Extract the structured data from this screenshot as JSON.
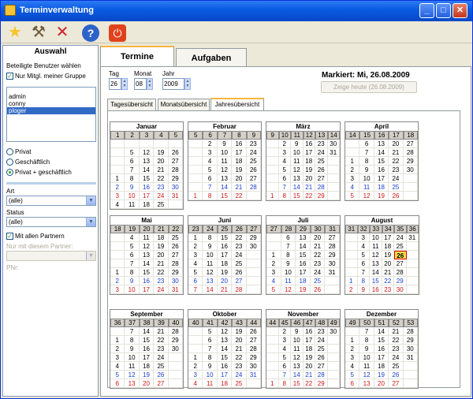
{
  "window": {
    "title": "Terminverwaltung"
  },
  "toolbar": {
    "icons": [
      "star-icon",
      "tools-icon",
      "delete-icon",
      "help-icon",
      "power-icon"
    ]
  },
  "left": {
    "title": "Auswahl",
    "users_label": "Beteiligte Benutzer wählen",
    "group_only": "Nur Mitgl. meiner Gruppe",
    "users": [
      "admin",
      "conny",
      "ploger"
    ],
    "selected_user": "ploger",
    "radios": [
      "Privat",
      "Geschäftlich",
      "Privat + geschäftlich"
    ],
    "art_label": "Art",
    "art_value": "(alle)",
    "status_label": "Status",
    "status_value": "(alle)",
    "partners_label": "Mit allen Partnern",
    "partner_only_label": "Nur mit diesem Partner:",
    "pnr_label": "PNr:"
  },
  "tabs": [
    "Termine",
    "Aufgaben"
  ],
  "date": {
    "tag_label": "Tag",
    "monat_label": "Monat",
    "jahr_label": "Jahr",
    "tag": "26",
    "monat": "08",
    "jahr": "2009"
  },
  "marked": "Markiert: Mi, 26.08.2009",
  "today_button": "Zeige heute (26.08.2009)",
  "subtabs": [
    "Tagesübersicht",
    "Monatsübersicht",
    "Jahresübersicht"
  ],
  "colors": {
    "accent": "#0a5ce3",
    "sunday": "#d01414",
    "holiday_blue": "#1a3ecc",
    "today": "#f0e04a"
  },
  "months": [
    {
      "name": "Januar",
      "weeks": [
        "1",
        "2",
        "3",
        "4",
        "5"
      ],
      "days": [
        "",
        "",
        "",
        "",
        "",
        "",
        "5",
        "12",
        "19",
        "26",
        "",
        "6",
        "13",
        "20",
        "27",
        "",
        "7",
        "14",
        "21",
        "28",
        "1",
        "8",
        "15",
        "22",
        "29",
        "2",
        "9",
        "16",
        "23",
        "30",
        "3",
        "10",
        "17",
        "24",
        "31",
        "4",
        "11",
        "18",
        "25",
        ""
      ]
    },
    {
      "name": "Februar",
      "weeks": [
        "5",
        "6",
        "7",
        "8",
        "9"
      ],
      "days": [
        "",
        "2",
        "9",
        "16",
        "23",
        "",
        "3",
        "10",
        "17",
        "24",
        "",
        "4",
        "11",
        "18",
        "25",
        "",
        "5",
        "12",
        "19",
        "26",
        "",
        "6",
        "13",
        "20",
        "27",
        "",
        "7",
        "14",
        "21",
        "28",
        "1",
        "8",
        "15",
        "22",
        ""
      ]
    },
    {
      "name": "März",
      "weeks": [
        "9",
        "10",
        "11",
        "12",
        "13",
        "14"
      ],
      "days": [
        "",
        "2",
        "9",
        "16",
        "23",
        "30",
        "",
        "3",
        "10",
        "17",
        "24",
        "31",
        "",
        "4",
        "11",
        "18",
        "25",
        "",
        "",
        "5",
        "12",
        "19",
        "26",
        "",
        "",
        "6",
        "13",
        "20",
        "27",
        "",
        "",
        "7",
        "14",
        "21",
        "28",
        "",
        "1",
        "8",
        "15",
        "22",
        "29",
        ""
      ]
    },
    {
      "name": "April",
      "weeks": [
        "14",
        "15",
        "16",
        "17",
        "18"
      ],
      "days": [
        "",
        "6",
        "13",
        "20",
        "27",
        "",
        "7",
        "14",
        "21",
        "28",
        "1",
        "8",
        "15",
        "22",
        "29",
        "2",
        "9",
        "16",
        "23",
        "30",
        "3",
        "10",
        "17",
        "24",
        "",
        "4",
        "11",
        "18",
        "25",
        "",
        "5",
        "12",
        "19",
        "26",
        ""
      ]
    },
    {
      "name": "Mai",
      "weeks": [
        "18",
        "19",
        "20",
        "21",
        "22"
      ],
      "days": [
        "",
        "4",
        "11",
        "18",
        "25",
        "",
        "5",
        "12",
        "19",
        "26",
        "",
        "6",
        "13",
        "20",
        "27",
        "",
        "7",
        "14",
        "21",
        "28",
        "1",
        "8",
        "15",
        "22",
        "29",
        "2",
        "9",
        "16",
        "23",
        "30",
        "3",
        "10",
        "17",
        "24",
        "31"
      ]
    },
    {
      "name": "Juni",
      "weeks": [
        "23",
        "24",
        "25",
        "26",
        "27"
      ],
      "days": [
        "1",
        "8",
        "15",
        "22",
        "29",
        "2",
        "9",
        "16",
        "23",
        "30",
        "3",
        "10",
        "17",
        "24",
        "",
        "4",
        "11",
        "18",
        "25",
        "",
        "5",
        "12",
        "19",
        "26",
        "",
        "6",
        "13",
        "20",
        "27",
        "",
        "7",
        "14",
        "21",
        "28",
        ""
      ]
    },
    {
      "name": "Juli",
      "weeks": [
        "27",
        "28",
        "29",
        "30",
        "31"
      ],
      "days": [
        "",
        "6",
        "13",
        "20",
        "27",
        "",
        "7",
        "14",
        "21",
        "28",
        "1",
        "8",
        "15",
        "22",
        "29",
        "2",
        "9",
        "16",
        "23",
        "30",
        "3",
        "10",
        "17",
        "24",
        "31",
        "4",
        "11",
        "18",
        "25",
        "",
        "5",
        "12",
        "19",
        "26",
        ""
      ]
    },
    {
      "name": "August",
      "weeks": [
        "31",
        "32",
        "33",
        "34",
        "35",
        "36"
      ],
      "days": [
        "",
        "3",
        "10",
        "17",
        "24",
        "31",
        "",
        "4",
        "11",
        "18",
        "25",
        "",
        "",
        "5",
        "12",
        "19",
        "26",
        "",
        "",
        "6",
        "13",
        "20",
        "27",
        "",
        "",
        "7",
        "14",
        "21",
        "28",
        "",
        "1",
        "8",
        "15",
        "22",
        "29",
        "",
        "2",
        "9",
        "16",
        "23",
        "30",
        ""
      ]
    },
    {
      "name": "September",
      "weeks": [
        "36",
        "37",
        "38",
        "39",
        "40"
      ],
      "days": [
        "",
        "7",
        "14",
        "21",
        "28",
        "1",
        "8",
        "15",
        "22",
        "29",
        "2",
        "9",
        "16",
        "23",
        "30",
        "3",
        "10",
        "17",
        "24",
        "",
        "4",
        "11",
        "18",
        "25",
        "",
        "5",
        "12",
        "19",
        "26",
        "",
        "6",
        "13",
        "20",
        "27",
        ""
      ]
    },
    {
      "name": "Oktober",
      "weeks": [
        "40",
        "41",
        "42",
        "43",
        "44"
      ],
      "days": [
        "",
        "5",
        "12",
        "19",
        "26",
        "",
        "6",
        "13",
        "20",
        "27",
        "",
        "7",
        "14",
        "21",
        "28",
        "1",
        "8",
        "15",
        "22",
        "29",
        "2",
        "9",
        "16",
        "23",
        "30",
        "3",
        "10",
        "17",
        "24",
        "31",
        "4",
        "11",
        "18",
        "25",
        ""
      ]
    },
    {
      "name": "November",
      "weeks": [
        "44",
        "45",
        "46",
        "47",
        "48",
        "49"
      ],
      "days": [
        "",
        "2",
        "9",
        "16",
        "23",
        "30",
        "",
        "3",
        "10",
        "17",
        "24",
        "",
        "",
        "4",
        "11",
        "18",
        "25",
        "",
        "",
        "5",
        "12",
        "19",
        "26",
        "",
        "",
        "6",
        "13",
        "20",
        "27",
        "",
        "",
        "7",
        "14",
        "21",
        "28",
        "",
        "1",
        "8",
        "15",
        "22",
        "29",
        ""
      ]
    },
    {
      "name": "Dezember",
      "weeks": [
        "49",
        "50",
        "51",
        "52",
        "53"
      ],
      "days": [
        "",
        "7",
        "14",
        "21",
        "28",
        "1",
        "8",
        "15",
        "22",
        "29",
        "2",
        "9",
        "16",
        "23",
        "30",
        "3",
        "10",
        "17",
        "24",
        "31",
        "4",
        "11",
        "18",
        "25",
        "",
        "5",
        "12",
        "19",
        "26",
        "",
        "6",
        "13",
        "20",
        "27",
        ""
      ]
    }
  ]
}
